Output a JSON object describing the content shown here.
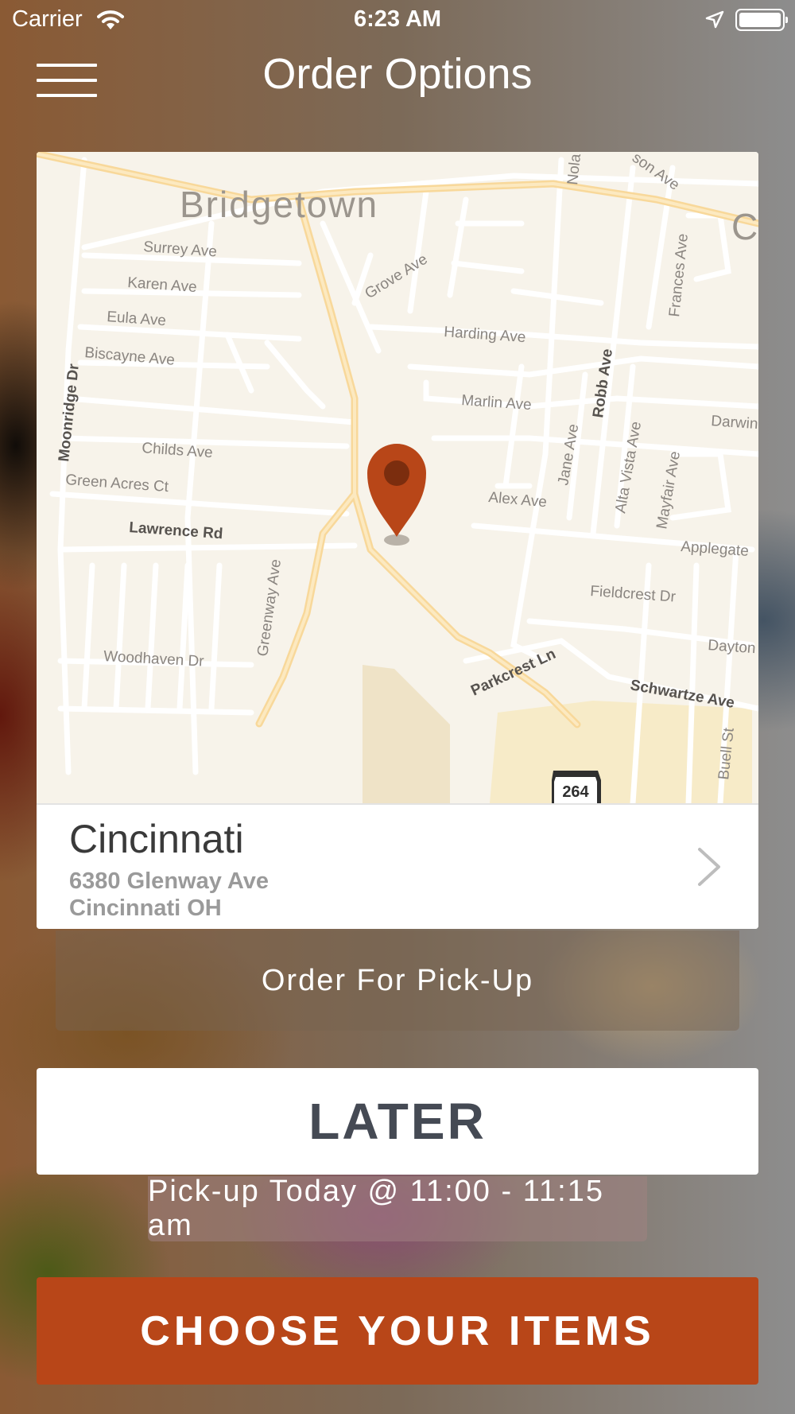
{
  "status_bar": {
    "carrier": "Carrier",
    "time": "6:23 AM"
  },
  "nav": {
    "title": "Order Options"
  },
  "map": {
    "area_label": "Bridgetown",
    "edge_letter": "C",
    "route_shield": "264",
    "streets": [
      "Surrey Ave",
      "Karen Ave",
      "Eula Ave",
      "Biscayne Ave",
      "Moonridge Dr",
      "Childs Ave",
      "Green Acres Ct",
      "Lawrence Rd",
      "Woodhaven Dr",
      "Greenway Ave",
      "Grove Ave",
      "Harding Ave",
      "Marlin Ave",
      "Alex Ave",
      "Jane Ave",
      "Robb Ave",
      "Alta Vista Ave",
      "Mayfair Ave",
      "Frances Ave",
      "Darwin",
      "Applegate",
      "Fieldcrest Dr",
      "Dayton",
      "Parkcrest Ln",
      "Schwartze Ave",
      "Buell St",
      "Nola",
      "son Ave"
    ]
  },
  "location": {
    "city": "Cincinnati",
    "address_line1": "6380 Glenway Ave",
    "address_line2": "Cincinnati OH"
  },
  "order_type": {
    "label": "Order For Pick-Up"
  },
  "timing": {
    "selected_label": "LATER",
    "pickup_time": "Pick-up Today @ 11:00 - 11:15 am"
  },
  "cta": {
    "label": "CHOOSE YOUR ITEMS"
  },
  "colors": {
    "accent": "#b84618",
    "later_text": "#454a54",
    "map_bg": "#f7f3ea"
  }
}
